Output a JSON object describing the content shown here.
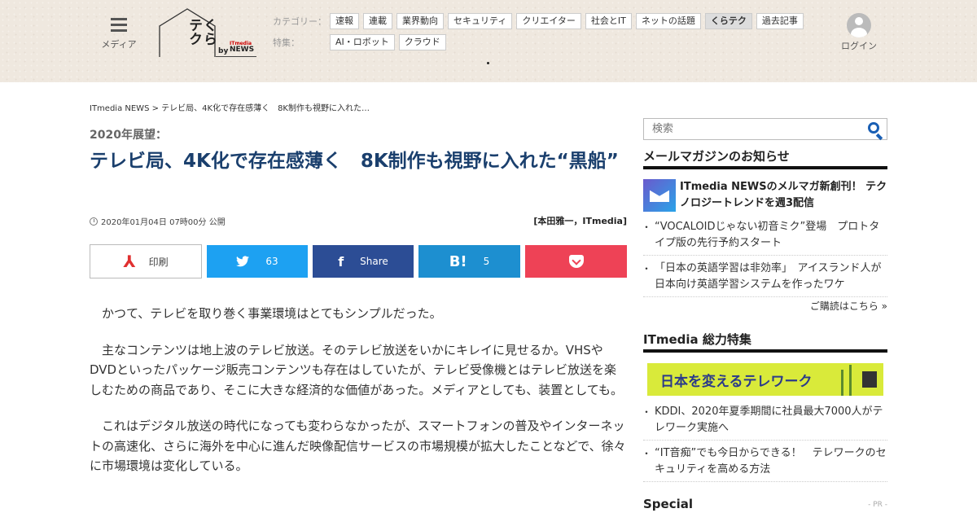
{
  "header": {
    "menu_label": "メディア",
    "logo": {
      "title": "くらテク",
      "by": "by",
      "brand_small": "ITmedia",
      "brand": "NEWS"
    },
    "category_label": "カテゴリー：",
    "categories": [
      "速報",
      "連載",
      "業界動向",
      "セキュリティ",
      "クリエイター",
      "社会とIT",
      "ネットの話題",
      "くらテク",
      "過去記事"
    ],
    "active_category": "くらテク",
    "feature_label": "特集：",
    "features": [
      "AI・ロボット",
      "クラウド"
    ],
    "login_label": "ログイン"
  },
  "breadcrumb": "ITmedia NEWS > テレビ局、4K化で存在感薄く　8K制作も視野に入れた…",
  "article": {
    "kicker": "2020年展望：",
    "title": "テレビ局、4K化で存在感薄く　8K制作も視野に入れた“黒船”",
    "date": "2020年01月04日 07時00分 公開",
    "author": "[本田雅一，ITmedia]",
    "share": {
      "print": "印刷",
      "twitter_count": "63",
      "facebook": "Share",
      "hatena_count": "5"
    },
    "paragraphs": [
      "かつて、テレビを取り巻く事業環境はとてもシンプルだった。",
      "主なコンテンツは地上波のテレビ放送。そのテレビ放送をいかにキレイに見せるか。VHSやDVDといったパッケージ販売コンテンツも存在はしていたが、テレビ受像機とはテレビ放送を楽しむための商品であり、そこに大きな経済的な価値があった。メディアとしても、装置としても。",
      "これはデジタル放送の時代になっても変わらなかったが、スマートフォンの普及やインターネットの高速化、さらに海外を中心に進んだ映像配信サービスの市場規模が拡大したことなどで、徐々に市場環境は変化している。"
    ]
  },
  "sidebar": {
    "search_placeholder": "検索",
    "mail_heading": "メールマガジンのお知らせ",
    "mail_feature": "ITmedia NEWSのメルマガ新創刊！ テクノロジートレンドを週3配信",
    "mail_items": [
      "“VOCALOIDじゃない初音ミク”登場　プロトタイプ版の先行予約スタート",
      "「日本の英語学習は非効率」　アイスランド人が日本向け英語学習システムを作ったワケ"
    ],
    "more": "ご購読はこちら »",
    "it_heading": "ITmedia 総力特集",
    "banner_text": "日本を変えるテレワーク",
    "it_items": [
      "KDDI、2020年夏季期間に社員最大7000人がテレワーク実施へ",
      "“IT音痴”でも今日からできる！　テレワークのセキュリティを高める方法"
    ],
    "special_heading": "Special",
    "special_pr": "- PR -"
  }
}
